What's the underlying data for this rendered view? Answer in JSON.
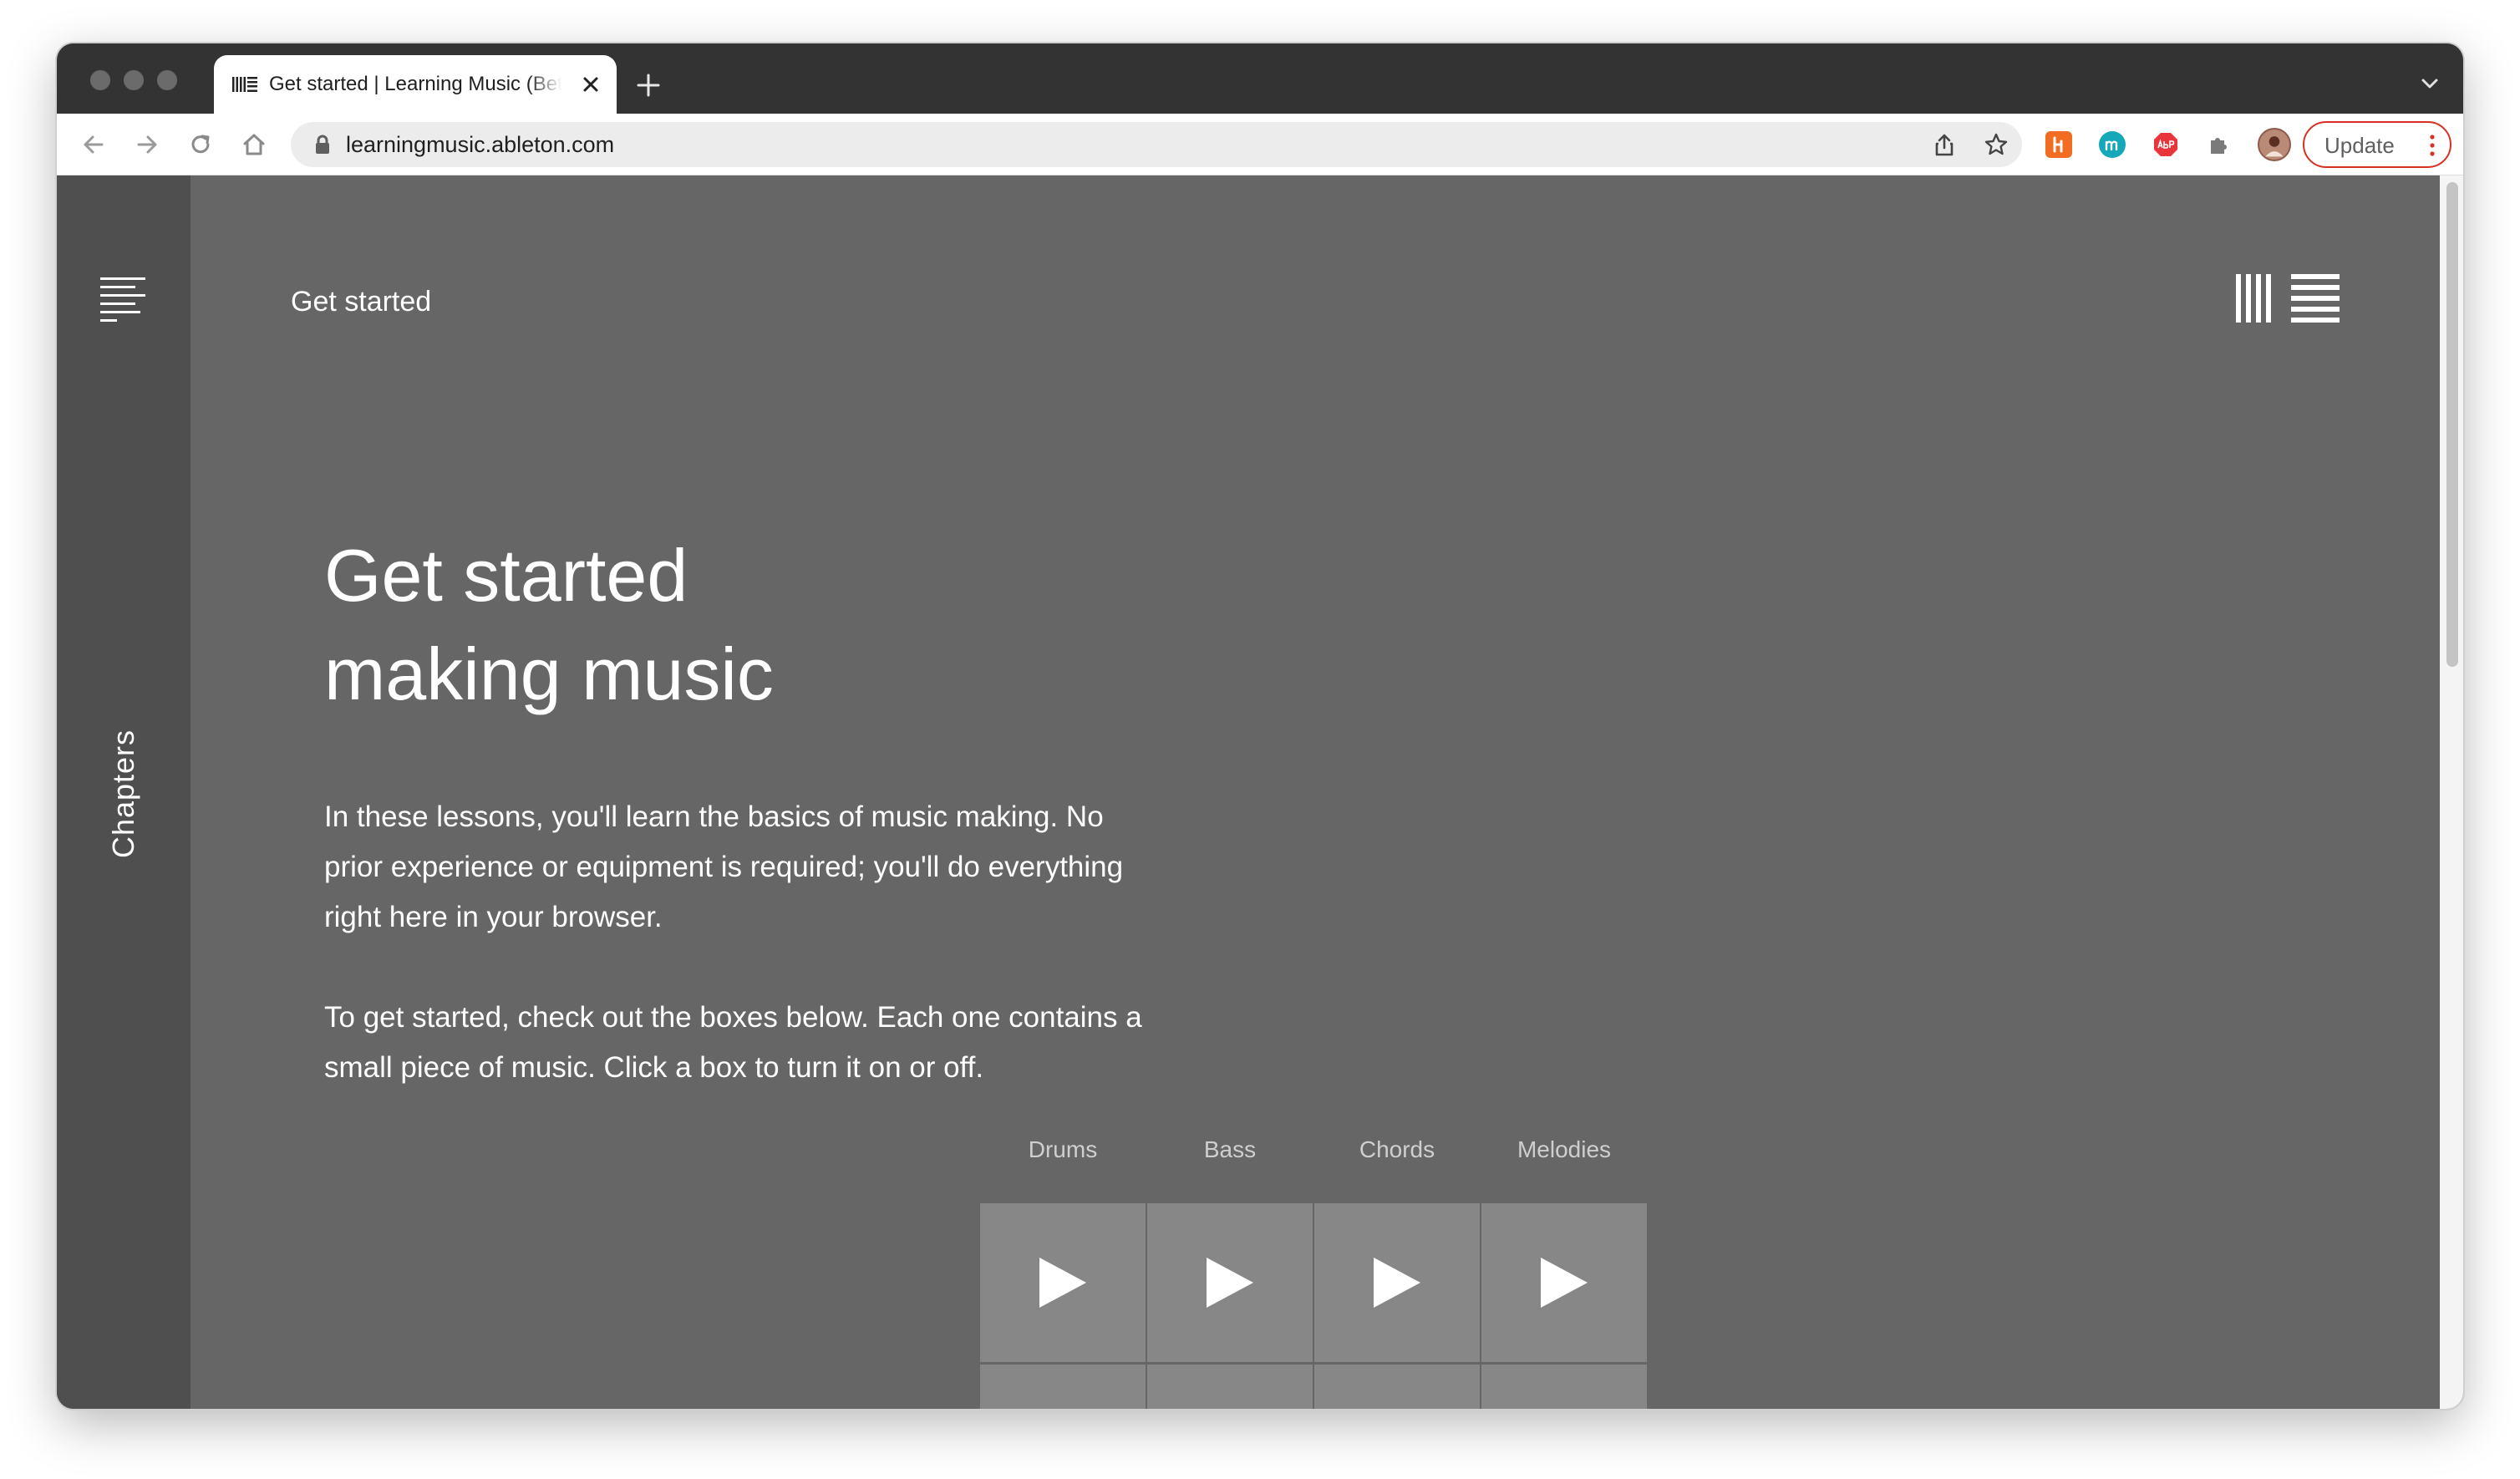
{
  "browser": {
    "tab_title": "Get started | Learning Music (Beta)",
    "url": "learningmusic.ableton.com",
    "update_label": "Update",
    "extensions": [
      "honey-icon",
      "m-extension-icon",
      "adblock-plus-icon",
      "puzzle-icon",
      "profile-avatar"
    ],
    "colors": {
      "tab_strip": "#333333",
      "update_border": "#d93025"
    }
  },
  "site": {
    "sidebar_label": "Chapters",
    "breadcrumb": "Get started",
    "headline_line1": "Get started",
    "headline_line2": "making music",
    "intro_paragraph": "In these lessons, you'll learn the basics of music making. No prior experience or equipment is required; you'll do everything right here in your browser.",
    "instruction_paragraph": "To get started, check out the boxes below. Each one contains a small piece of music. Click a box to turn it on or off.",
    "columns": [
      "Drums",
      "Bass",
      "Chords",
      "Melodies"
    ],
    "colors": {
      "page_bg": "#666666",
      "sidebar_bg": "#4f4f4f",
      "pad_bg": "#878787"
    }
  }
}
